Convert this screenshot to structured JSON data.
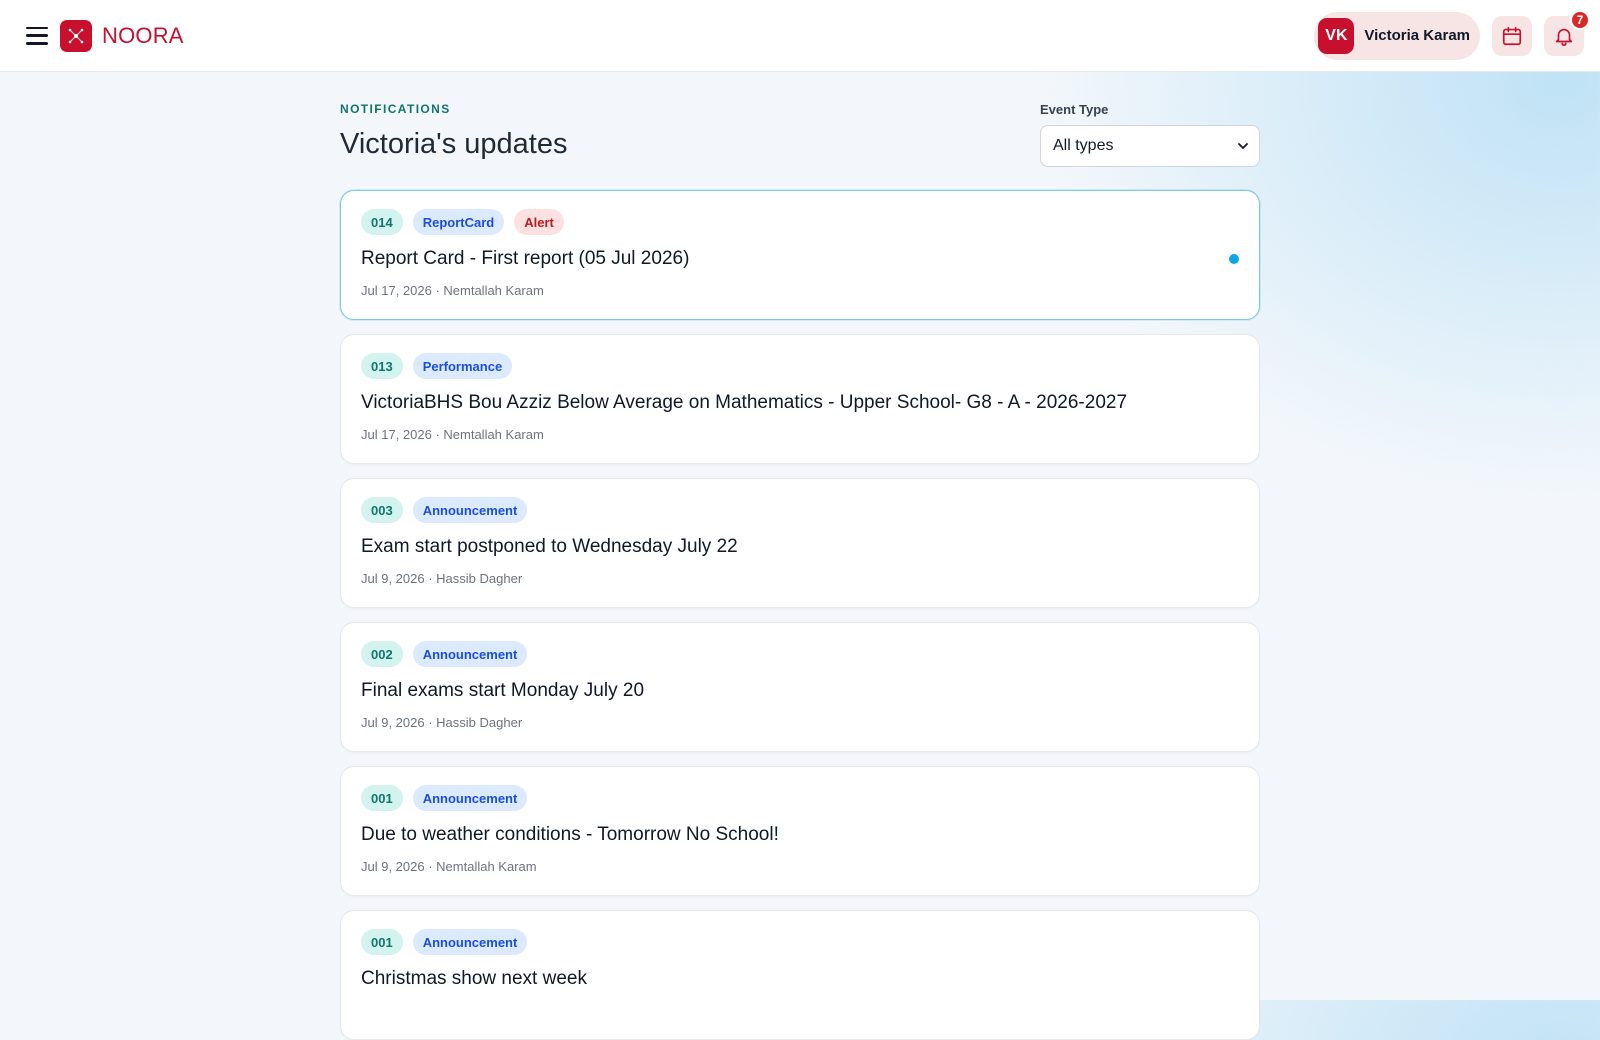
{
  "app": {
    "brand": "NOORA",
    "brand_color": "#c8102e"
  },
  "header": {
    "user_initials": "VK",
    "user_name": "Victoria Karam",
    "notification_count": "7",
    "icons": [
      "menu-icon",
      "logo-icon",
      "calendar-icon",
      "bell-icon"
    ]
  },
  "page": {
    "eyebrow": "NOTIFICATIONS",
    "title": "Victoria's updates"
  },
  "filter": {
    "label": "Event Type",
    "selected": "All types"
  },
  "notifications": [
    {
      "id": "014",
      "tags": [
        "ReportCard",
        "Alert"
      ],
      "title": "Report Card - First report (05 Jul 2026)",
      "meta": "Jul 17, 2026 · Nemtallah Karam",
      "unread": true
    },
    {
      "id": "013",
      "tags": [
        "Performance"
      ],
      "title": "VictoriaBHS Bou Azziz Below Average on Mathematics - Upper School- G8 - A - 2026-2027",
      "meta": "Jul 17, 2026 · Nemtallah Karam",
      "unread": false
    },
    {
      "id": "003",
      "tags": [
        "Announcement"
      ],
      "title": "Exam start postponed to Wednesday July 22",
      "meta": "Jul 9, 2026 · Hassib Dagher",
      "unread": false
    },
    {
      "id": "002",
      "tags": [
        "Announcement"
      ],
      "title": "Final exams start Monday July 20",
      "meta": "Jul 9, 2026 · Hassib Dagher",
      "unread": false
    },
    {
      "id": "001",
      "tags": [
        "Announcement"
      ],
      "title": "Due to weather conditions - Tomorrow No School!",
      "meta": "Jul 9, 2026 · Nemtallah Karam",
      "unread": false
    },
    {
      "id": "001",
      "tags": [
        "Announcement"
      ],
      "title": "Christmas show next week",
      "meta": "",
      "unread": false
    }
  ],
  "colors": {
    "accent_red": "#c8102e",
    "teal": "#0f766e",
    "blue_tag": "#1d4ed8",
    "alert_tag": "#b91c1c",
    "unread_dot": "#0ea5e9"
  }
}
